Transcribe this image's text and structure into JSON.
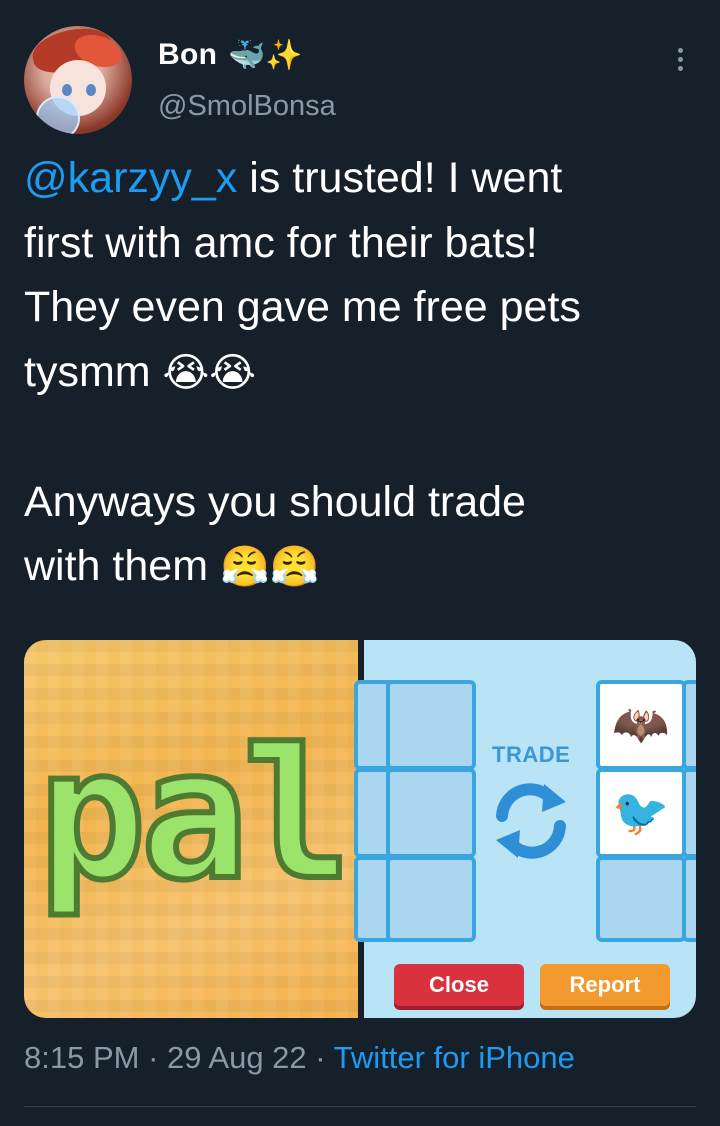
{
  "author": {
    "name": "Bon",
    "name_emojis": "🐳✨",
    "handle": "@SmolBonsa"
  },
  "tweet": {
    "mention": "@karzyy_x",
    "line1_rest": " is trusted! I went",
    "line2": "first with amc for their bats!",
    "line3": "They even gave me free pets",
    "line4": "tysmm ",
    "line4_emoji": "😭😭",
    "line6": "Anyways you should trade",
    "line7": "with them ",
    "line7_emoji": "😤😤"
  },
  "media": {
    "left_text": "pal",
    "trade_label": "TRADE",
    "close_label": "Close",
    "report_label": "Report",
    "pet_1_emoji": "🦇",
    "pet_2_emoji": "🐦"
  },
  "meta": {
    "time": "8:15 PM",
    "sep1": " · ",
    "date": "29 Aug 22",
    "sep2": " · ",
    "source": "Twitter for iPhone"
  },
  "icons": {
    "more": "more-vertical-icon",
    "refresh": "refresh-icon"
  },
  "colors": {
    "background": "#15202b",
    "link": "#1d9bf0",
    "secondary_text": "#8b98a5"
  }
}
